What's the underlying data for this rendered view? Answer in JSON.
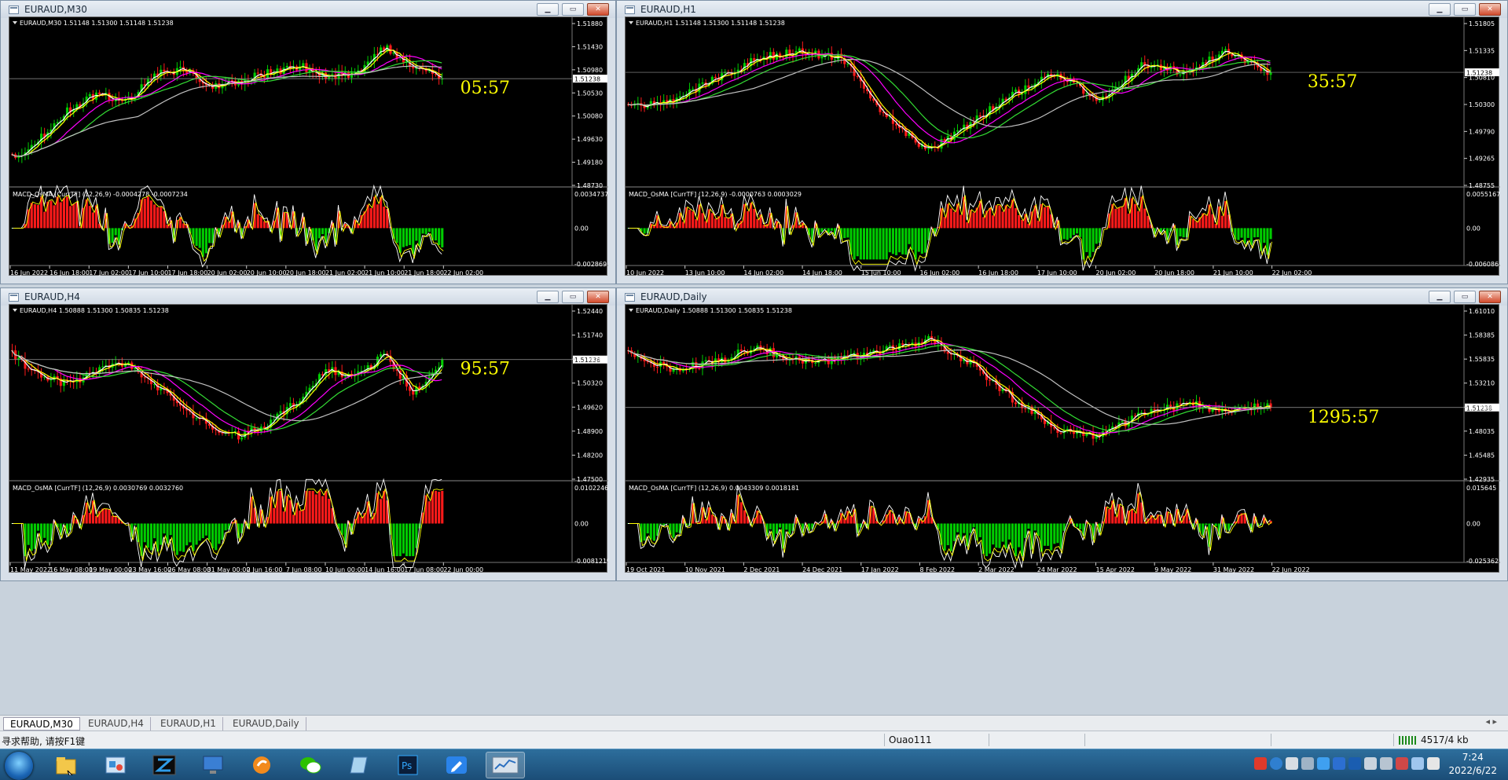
{
  "windows": [
    {
      "title": "EURAUD,M30",
      "symbol_label": "EURAUD,M30",
      "ohlc": "1.51148 1.51300 1.51148 1.51238",
      "countdown": "05:57",
      "current_price": "1.51238",
      "price_ticks": [
        "1.51880",
        "1.51430",
        "1.50980",
        "1.50530",
        "1.50080",
        "1.49630",
        "1.49180",
        "1.48730"
      ],
      "indicator": "MACD_OsMA [CurrTF] (12,26,9) -0.0004278 -0.0007234",
      "ind_ticks": [
        "0.0034737",
        "0.00",
        "-0.002869"
      ],
      "time_ticks": [
        "16 Jun 2022",
        "16 Jun 18:00",
        "17 Jun 02:00",
        "17 Jun 10:00",
        "17 Jun 18:00",
        "20 Jun 02:00",
        "20 Jun 10:00",
        "20 Jun 18:00",
        "21 Jun 02:00",
        "21 Jun 10:00",
        "21 Jun 18:00",
        "22 Jun 02:00"
      ]
    },
    {
      "title": "EURAUD,H1",
      "symbol_label": "EURAUD,H1",
      "ohlc": "1.51148 1.51300 1.51148 1.51238",
      "countdown": "35:57",
      "current_price": "1.51238",
      "price_ticks": [
        "1.51805",
        "1.51335",
        "1.50810",
        "1.50300",
        "1.49790",
        "1.49265",
        "1.48755"
      ],
      "indicator": "MACD_OsMA [CurrTF] (12,26,9) -0.0000763 0.0003029",
      "ind_ticks": [
        "0.0055167",
        "0.00",
        "-0.006086"
      ],
      "time_ticks": [
        "10 Jun 2022",
        "13 Jun 10:00",
        "14 Jun 02:00",
        "14 Jun 18:00",
        "15 Jun 10:00",
        "16 Jun 02:00",
        "16 Jun 18:00",
        "17 Jun 10:00",
        "20 Jun 02:00",
        "20 Jun 18:00",
        "21 Jun 10:00",
        "22 Jun 02:00"
      ]
    },
    {
      "title": "EURAUD,H4",
      "symbol_label": "EURAUD,H4",
      "ohlc": "1.50888 1.51300 1.50835 1.51238",
      "countdown": "95:57",
      "current_price": "1.51238",
      "price_ticks": [
        "1.52440",
        "1.51740",
        "1.51020",
        "1.50320",
        "1.49620",
        "1.48900",
        "1.48200",
        "1.47500"
      ],
      "indicator": "MACD_OsMA [CurrTF] (12,26,9) 0.0030769 0.0032760",
      "ind_ticks": [
        "0.0102246",
        "0.00",
        "-0.0081219"
      ],
      "time_ticks": [
        "11 May 2022",
        "16 May 08:00",
        "19 May 00:00",
        "23 May 16:00",
        "26 May 08:00",
        "31 May 00:00",
        "2 Jun 16:00",
        "7 Jun 08:00",
        "10 Jun 00:00",
        "14 Jun 16:00",
        "17 Jun 08:00",
        "22 Jun 00:00"
      ]
    },
    {
      "title": "EURAUD,Daily",
      "symbol_label": "EURAUD,Daily",
      "ohlc": "1.50888 1.51300 1.50835 1.51238",
      "countdown": "1295:57",
      "current_price": "1.51238",
      "price_ticks": [
        "1.61010",
        "1.58385",
        "1.55835",
        "1.53210",
        "1.50660",
        "1.48035",
        "1.45485",
        "1.42935"
      ],
      "indicator": "MACD_OsMA [CurrTF] (12,26,9) 0.0043309 0.0018181",
      "ind_ticks": [
        "0.015645",
        "0.00",
        "-0.025362"
      ],
      "time_ticks": [
        "19 Oct 2021",
        "10 Nov 2021",
        "2 Dec 2021",
        "24 Dec 2021",
        "17 Jan 2022",
        "8 Feb 2022",
        "2 Mar 2022",
        "24 Mar 2022",
        "15 Apr 2022",
        "9 May 2022",
        "31 May 2022",
        "22 Jun 2022"
      ]
    }
  ],
  "tabs": [
    "EURAUD,M30",
    "EURAUD,H4",
    "EURAUD,H1",
    "EURAUD,Daily"
  ],
  "active_tab": 0,
  "tab_nav": "◂ ▸",
  "window_buttons": {
    "minimize": "▁",
    "maximize": "▭",
    "close": "✕"
  },
  "status": {
    "help": "寻求帮助, 请按F1键",
    "profile": "Ouao111",
    "traffic": "4517/4 kb"
  },
  "clock": {
    "time": "7:24",
    "date": "2022/6/22"
  },
  "colors": {
    "bull": "#00cc00",
    "bear": "#ff1a1a",
    "countdown": "#ffff00",
    "ma_fast": "#ffffff",
    "ma_yellow": "#ffff00",
    "ma_magenta": "#ff00ff",
    "ma_green": "#33dd33",
    "ma_gray": "#c0c0c0"
  }
}
